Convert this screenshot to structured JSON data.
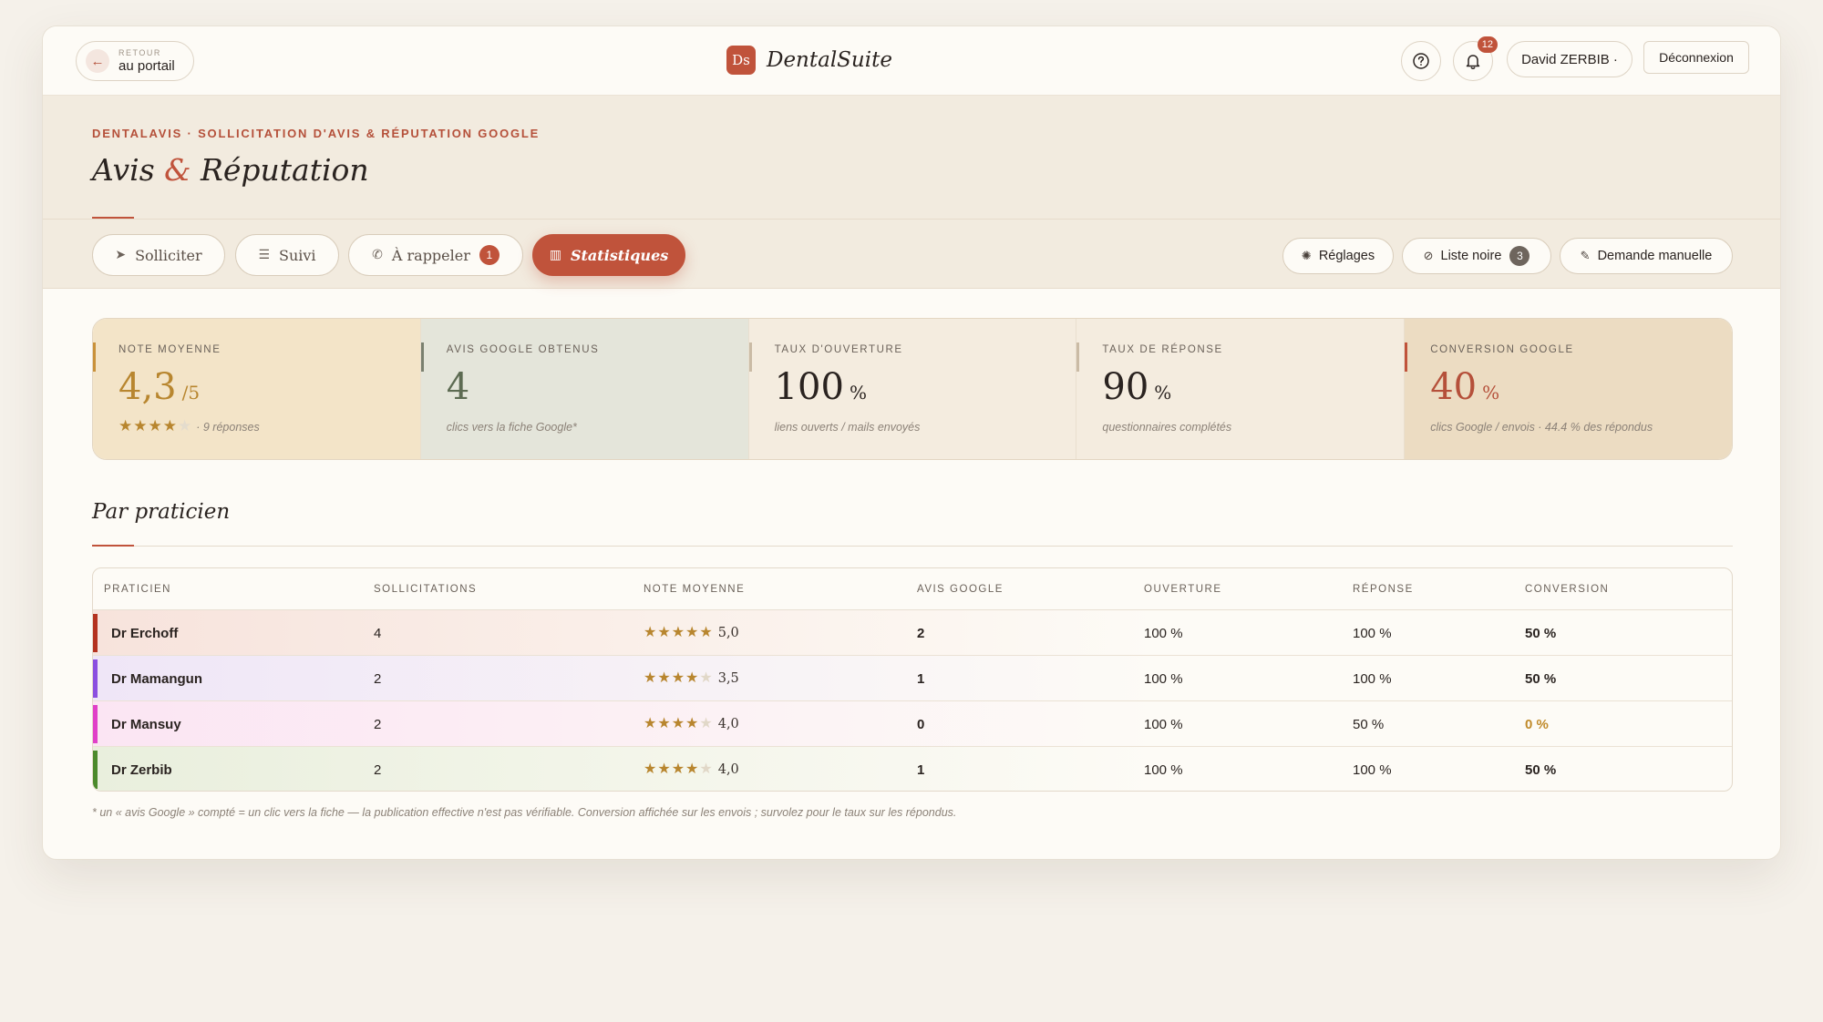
{
  "topbar": {
    "back_small": "RETOUR",
    "back_label": "au portail",
    "brand_logo": "Ds",
    "brand_name": "DentalSuite",
    "help_icon": "help-circle-icon",
    "notifications_count": "12",
    "user_name": "David ZERBIB ·",
    "logout_label": "Déconnexion"
  },
  "header": {
    "eyebrow": "DENTALAVIS · SOLLICITATION D'AVIS & RÉPUTATION GOOGLE",
    "title_part1": "Avis",
    "title_amp": "&",
    "title_part2": "Réputation"
  },
  "tabs": [
    {
      "label": "Solliciter",
      "icon": "send-icon"
    },
    {
      "label": "Suivi",
      "icon": "list-icon"
    },
    {
      "label": "À rappeler",
      "icon": "phone-icon",
      "badge": "1"
    },
    {
      "label": "Statistiques",
      "icon": "bar-chart-icon",
      "active": true
    }
  ],
  "right_actions": [
    {
      "label": "Réglages",
      "icon": "settings-icon"
    },
    {
      "label": "Liste noire",
      "icon": "block-icon",
      "badge": "3"
    },
    {
      "label": "Demande manuelle",
      "icon": "pencil-icon"
    }
  ],
  "kpis": [
    {
      "label": "NOTE MOYENNE",
      "value": "4,3",
      "unit": "/5",
      "stars_filled": 4,
      "stars_total": 5,
      "sub": "· 9 réponses",
      "value_color": "#b8862f",
      "bg": "#f3e4c8",
      "bar": "#c9913a"
    },
    {
      "label": "AVIS GOOGLE OBTENUS",
      "value": "4",
      "unit": "",
      "sub": "clics vers la fiche Google*",
      "value_color": "#5d6b52",
      "bg": "#e4e5da",
      "bar": "#7a806f"
    },
    {
      "label": "TAUX D'OUVERTURE",
      "value": "100",
      "unit": "%",
      "sub": "liens ouverts / mails envoyés",
      "value_color": "#2a2320",
      "bg": "#f4ecdf",
      "bar": "#cabba5"
    },
    {
      "label": "TAUX DE RÉPONSE",
      "value": "90",
      "unit": "%",
      "sub": "questionnaires complétés",
      "value_color": "#2a2320",
      "bg": "#f4ecdf",
      "bar": "#cabba5"
    },
    {
      "label": "CONVERSION GOOGLE",
      "value": "40",
      "unit": "%",
      "sub": "clics Google / envois · 44.4 % des répondus",
      "value_color": "#b5503a",
      "bg": "#ecdcc2",
      "bar": "#c0533b"
    }
  ],
  "section": {
    "title": "Par praticien"
  },
  "table": {
    "columns": [
      "PRATICIEN",
      "SOLLICITATIONS",
      "NOTE MOYENNE",
      "AVIS GOOGLE",
      "OUVERTURE",
      "RÉPONSE",
      "CONVERSION"
    ],
    "rows": [
      {
        "name": "Dr Erchoff",
        "sollicitations": "4",
        "stars_filled": 5,
        "note": "5,0",
        "avis": "2",
        "ouverture": "100 %",
        "reponse": "100 %",
        "conversion": "50 %",
        "accent": "#b4321f",
        "tint": "#f7e3dc",
        "conv_warn": false
      },
      {
        "name": "Dr Mamangun",
        "sollicitations": "2",
        "stars_filled": 4,
        "note": "3,5",
        "avis": "1",
        "ouverture": "100 %",
        "reponse": "100 %",
        "conversion": "50 %",
        "accent": "#8b4fe0",
        "tint": "#efe6f7",
        "conv_warn": false
      },
      {
        "name": "Dr Mansuy",
        "sollicitations": "2",
        "stars_filled": 4,
        "note": "4,0",
        "avis": "0",
        "ouverture": "100 %",
        "reponse": "50 %",
        "conversion": "0 %",
        "accent": "#e040c8",
        "tint": "#fbe5f3",
        "conv_warn": true
      },
      {
        "name": "Dr Zerbib",
        "sollicitations": "2",
        "stars_filled": 4,
        "note": "4,0",
        "avis": "1",
        "ouverture": "100 %",
        "reponse": "100 %",
        "conversion": "50 %",
        "accent": "#4c8a2c",
        "tint": "#e9efdd",
        "conv_warn": false
      }
    ]
  },
  "footnote": "* un « avis Google » compté = un clic vers la fiche — la publication effective n'est pas vérifiable. Conversion affichée sur les envois ; survolez pour le taux sur les répondus."
}
